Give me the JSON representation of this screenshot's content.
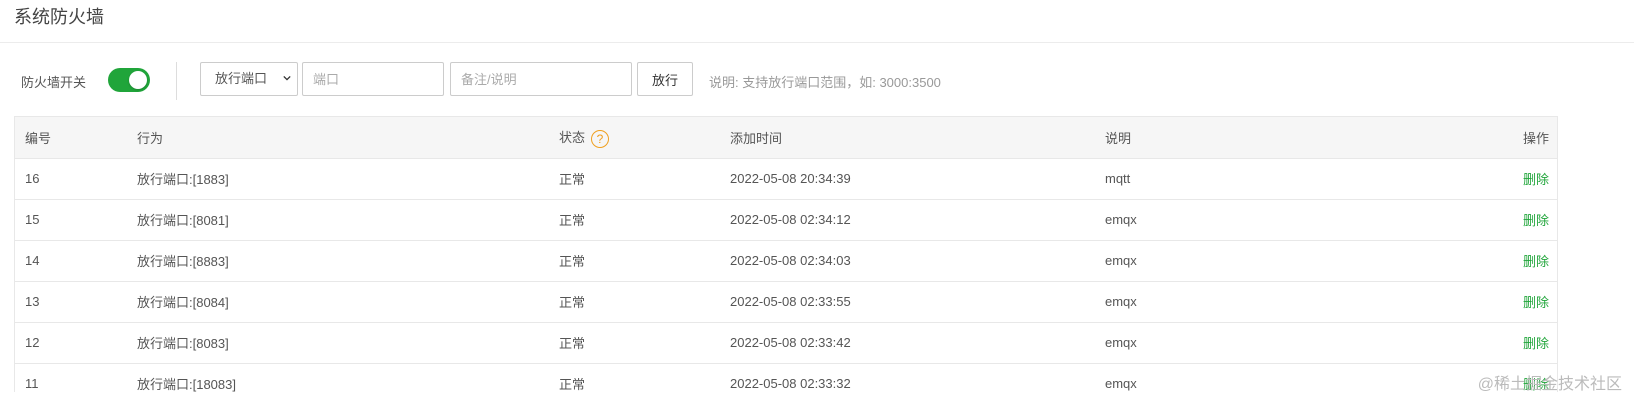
{
  "page": {
    "title": "系统防火墙"
  },
  "toolbar": {
    "firewall_label": "防火墙开关",
    "firewall_enabled": true,
    "select_value": "放行端口",
    "port_placeholder": "端口",
    "note_placeholder": "备注/说明",
    "allow_button": "放行",
    "hint": "说明: 支持放行端口范围，如: 3000:3500"
  },
  "colors": {
    "accent": "#20a53a",
    "help": "#f0a020"
  },
  "table": {
    "headers": {
      "id": "编号",
      "action": "行为",
      "status": "状态",
      "status_help": "?",
      "time": "添加时间",
      "note": "说明",
      "op": "操作"
    },
    "rows": [
      {
        "id": "16",
        "action": "放行端口:[1883]",
        "status": "正常",
        "time": "2022-05-08 20:34:39",
        "note": "mqtt",
        "op": "删除"
      },
      {
        "id": "15",
        "action": "放行端口:[8081]",
        "status": "正常",
        "time": "2022-05-08 02:34:12",
        "note": "emqx",
        "op": "删除"
      },
      {
        "id": "14",
        "action": "放行端口:[8883]",
        "status": "正常",
        "time": "2022-05-08 02:34:03",
        "note": "emqx",
        "op": "删除"
      },
      {
        "id": "13",
        "action": "放行端口:[8084]",
        "status": "正常",
        "time": "2022-05-08 02:33:55",
        "note": "emqx",
        "op": "删除"
      },
      {
        "id": "12",
        "action": "放行端口:[8083]",
        "status": "正常",
        "time": "2022-05-08 02:33:42",
        "note": "emqx",
        "op": "删除"
      },
      {
        "id": "11",
        "action": "放行端口:[18083]",
        "status": "正常",
        "time": "2022-05-08 02:33:32",
        "note": "emqx",
        "op": "删除"
      }
    ]
  },
  "watermark": "@稀土掘金技术社区"
}
